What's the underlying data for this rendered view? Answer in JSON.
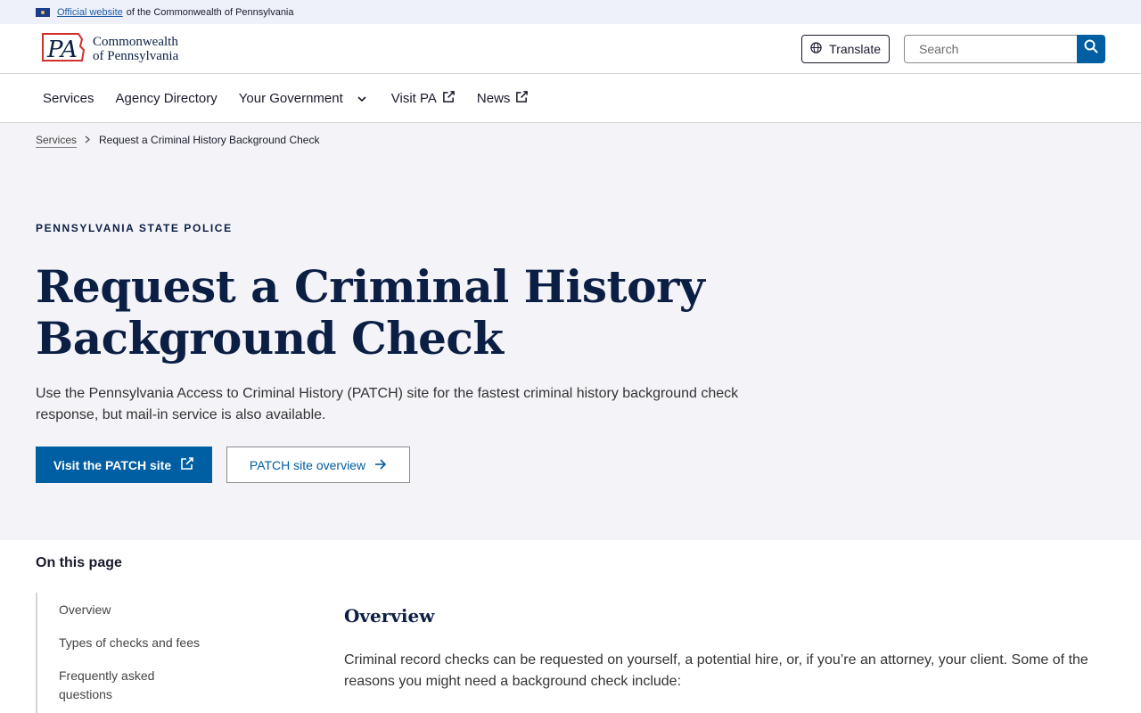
{
  "banner": {
    "link": "Official website",
    "text": "of the Commonwealth of Pennsylvania"
  },
  "logo": {
    "mark": "PA",
    "line1": "Commonwealth",
    "line2": "of Pennsylvania"
  },
  "header": {
    "translate_label": "Translate",
    "search_placeholder": "Search"
  },
  "nav": {
    "items": [
      {
        "label": "Services"
      },
      {
        "label": "Agency Directory"
      },
      {
        "label": "Your Government"
      },
      {
        "label": "Visit PA"
      },
      {
        "label": "News"
      }
    ]
  },
  "breadcrumb": {
    "parent": "Services",
    "current": "Request a Criminal History Background Check"
  },
  "hero": {
    "agency": "PENNSYLVANIA STATE POLICE",
    "title": "Request a Criminal History Background Check",
    "lede": "Use the Pennsylvania Access to Criminal History (PATCH) site for the fastest criminal history background check response, but mail-in service is also available.",
    "primary_button": "Visit the PATCH site",
    "secondary_button": "PATCH site overview"
  },
  "toc": {
    "heading": "On this page",
    "items": [
      "Overview",
      "Types of checks and fees",
      "Frequently asked questions"
    ]
  },
  "overview": {
    "title": "Overview",
    "text": "Criminal record checks can be requested on yourself, a potential hire, or, if you’re an attorney, your client. Some of the reasons you might need a background check include:"
  },
  "colors": {
    "primary": "#005ea2",
    "navy": "#0b1f44",
    "hero_bg": "#f4f4f8",
    "logo_red": "#d0312d"
  },
  "icons": [
    "flag-icon",
    "globe-icon",
    "search-icon",
    "chevron-down-icon",
    "external-link-icon",
    "arrow-right-icon",
    "chevron-right-icon"
  ]
}
